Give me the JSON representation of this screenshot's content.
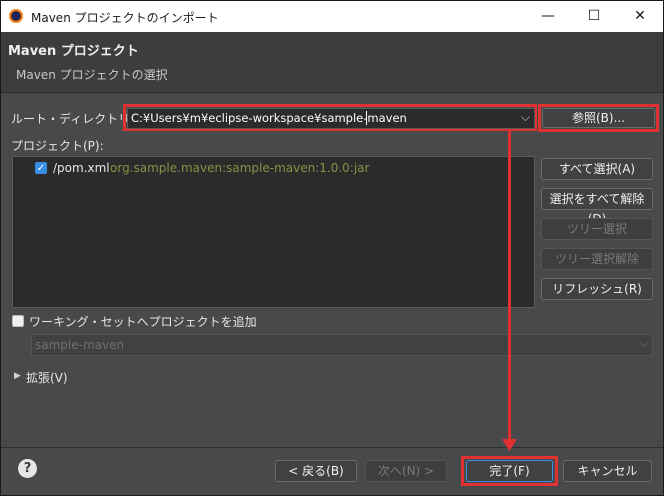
{
  "window": {
    "title": "Maven プロジェクトのインポート",
    "minimize": "—",
    "maximize": "☐",
    "close": "✕"
  },
  "header": {
    "title": "Maven プロジェクト",
    "subtitle": "Maven プロジェクトの選択"
  },
  "root_dir": {
    "label": "ルート・ディレクトリー(R):",
    "value": "C:¥Users¥m¥eclipse-workspace¥sample-maven",
    "browse_label": "参照(B)..."
  },
  "projects": {
    "label": "プロジェクト(P):",
    "items": [
      {
        "name": "/pom.xml",
        "artifact": "org.sample.maven:sample-maven:1.0.0:jar",
        "checked": true
      }
    ]
  },
  "side_buttons": {
    "select_all": "すべて選択(A)",
    "deselect_all": "選択をすべて解除(D)",
    "tree_select": "ツリー選択",
    "tree_deselect": "ツリー選択解除",
    "refresh": "リフレッシュ(R)"
  },
  "working_set": {
    "label": "ワーキング・セットへプロジェクトを追加",
    "checked": false,
    "value": "sample-maven"
  },
  "advanced": {
    "label": "拡張(V)"
  },
  "footer": {
    "help": "?",
    "back": "< 戻る(B)",
    "next": "次へ(N) >",
    "finish": "完了(F)",
    "cancel": "キャンセル"
  },
  "colors": {
    "highlight": "#e03131",
    "accent": "#3a8ee6"
  }
}
